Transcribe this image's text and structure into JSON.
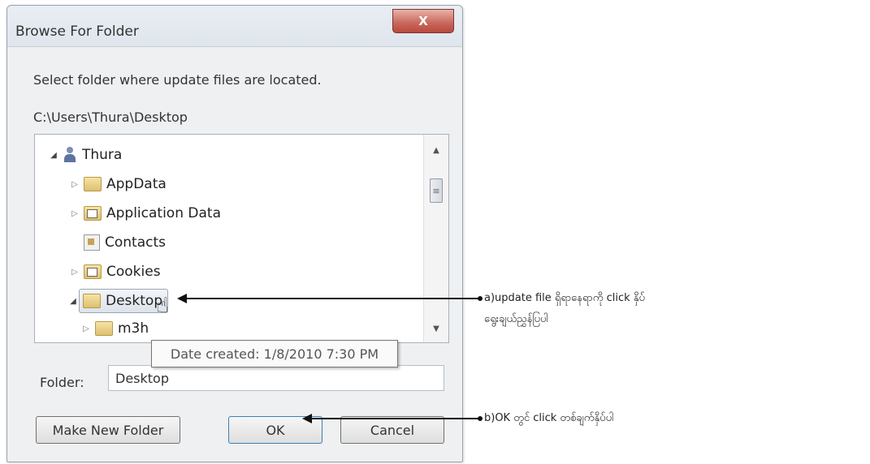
{
  "dialog": {
    "title": "Browse For Folder",
    "close_label": "X",
    "instruction": "Select folder where update files are located.",
    "path": "C:\\Users\\Thura\\Desktop"
  },
  "tree": {
    "items": [
      {
        "label": "Thura",
        "icon": "user-icon"
      },
      {
        "label": "AppData",
        "icon": "folder-icon"
      },
      {
        "label": "Application Data",
        "icon": "folder-shortcut-icon"
      },
      {
        "label": "Contacts",
        "icon": "contacts-icon"
      },
      {
        "label": "Cookies",
        "icon": "folder-shortcut-icon"
      },
      {
        "label": "Desktop",
        "icon": "folder-icon"
      },
      {
        "label": "m3h",
        "icon": "folder-icon"
      }
    ]
  },
  "tooltip": "Date created: 1/8/2010 7:30 PM",
  "folder": {
    "label": "Folder:",
    "value": "Desktop"
  },
  "buttons": {
    "make_new_folder": "Make New Folder",
    "ok": "OK",
    "cancel": "Cancel"
  },
  "annotations": {
    "a_line1": "a)update file ရှိရာနေရာကို click နှိပ်",
    "a_line2": "ရွေးချယ်ညွှန်ပြပါ",
    "b": "b)OK တွင် click တစ်ချက်နှိပ်ပါ"
  }
}
